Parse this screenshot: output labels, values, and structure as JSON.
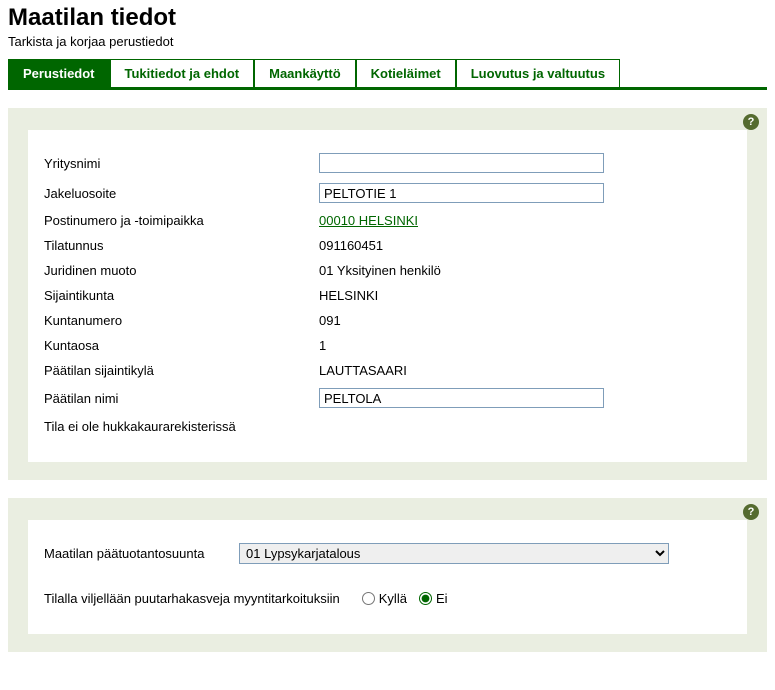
{
  "header": {
    "title": "Maatilan tiedot",
    "subtitle": "Tarkista ja korjaa perustiedot"
  },
  "tabs": [
    {
      "label": "Perustiedot",
      "active": true
    },
    {
      "label": "Tukitiedot ja ehdot",
      "active": false
    },
    {
      "label": "Maankäyttö",
      "active": false
    },
    {
      "label": "Kotieläimet",
      "active": false
    },
    {
      "label": "Luovutus ja valtuutus",
      "active": false
    }
  ],
  "fields": {
    "yritysnimi_label": "Yritysnimi",
    "yritysnimi_value": "",
    "jakeluosoite_label": "Jakeluosoite",
    "jakeluosoite_value": "PELTOTIE 1",
    "postinumero_label": "Postinumero ja -toimipaikka",
    "postinumero_value": "00010 HELSINKI",
    "tilatunnus_label": "Tilatunnus",
    "tilatunnus_value": "091160451",
    "juridinen_label": "Juridinen muoto",
    "juridinen_value": "01 Yksityinen henkilö",
    "sijaintikunta_label": "Sijaintikunta",
    "sijaintikunta_value": "HELSINKI",
    "kuntanumero_label": "Kuntanumero",
    "kuntanumero_value": "091",
    "kuntaosa_label": "Kuntaosa",
    "kuntaosa_value": "1",
    "paatila_sij_label": "Päätilan sijaintikylä",
    "paatila_sij_value": "LAUTTASAARI",
    "paatila_nimi_label": "Päätilan nimi",
    "paatila_nimi_value": "PELTOLA",
    "hukka_note": "Tila ei ole hukkakaurarekisterissä"
  },
  "panel2": {
    "paatuotanto_label": "Maatilan päätuotantosuunta",
    "paatuotanto_value": "01 Lypsykarjatalous",
    "viljely_label": "Tilalla viljellään puutarhakasveja myyntitarkoituksiin",
    "radio_yes": "Kyllä",
    "radio_no": "Ei",
    "selected": "no"
  },
  "help_glyph": "?"
}
